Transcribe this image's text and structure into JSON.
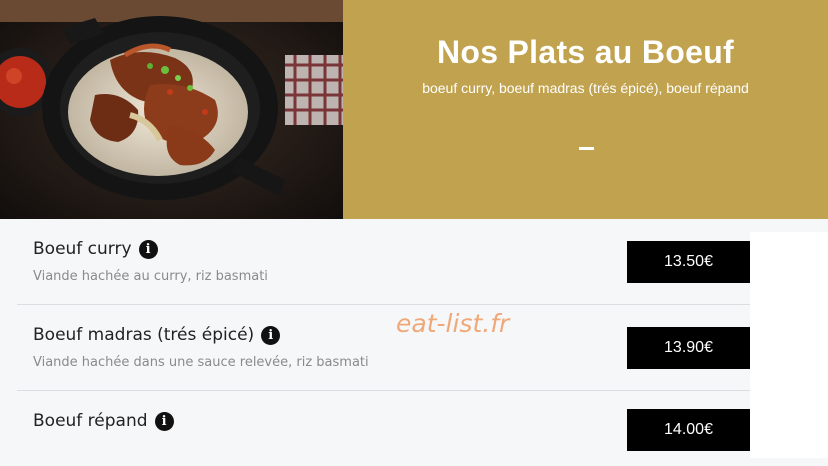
{
  "header": {
    "title": "Nos Plats au Boeuf",
    "subtitle": "boeuf curry, boeuf madras (trés épicé), boeuf répand",
    "accent_color": "#c0a24f",
    "image_icon": "beef-rice-bowl-photo"
  },
  "menu": {
    "items": [
      {
        "name": "Boeuf curry",
        "description": "Viande hachée au curry, riz basmati",
        "price": "13.50€",
        "info_icon": "info-icon"
      },
      {
        "name": "Boeuf madras (trés épicé)",
        "description": "Viande hachée dans une sauce relevée, riz basmati",
        "price": "13.90€",
        "info_icon": "info-icon"
      },
      {
        "name": "Boeuf répand",
        "description": "",
        "price": "14.00€",
        "info_icon": "info-icon"
      }
    ]
  },
  "watermark": "eat-list.fr"
}
